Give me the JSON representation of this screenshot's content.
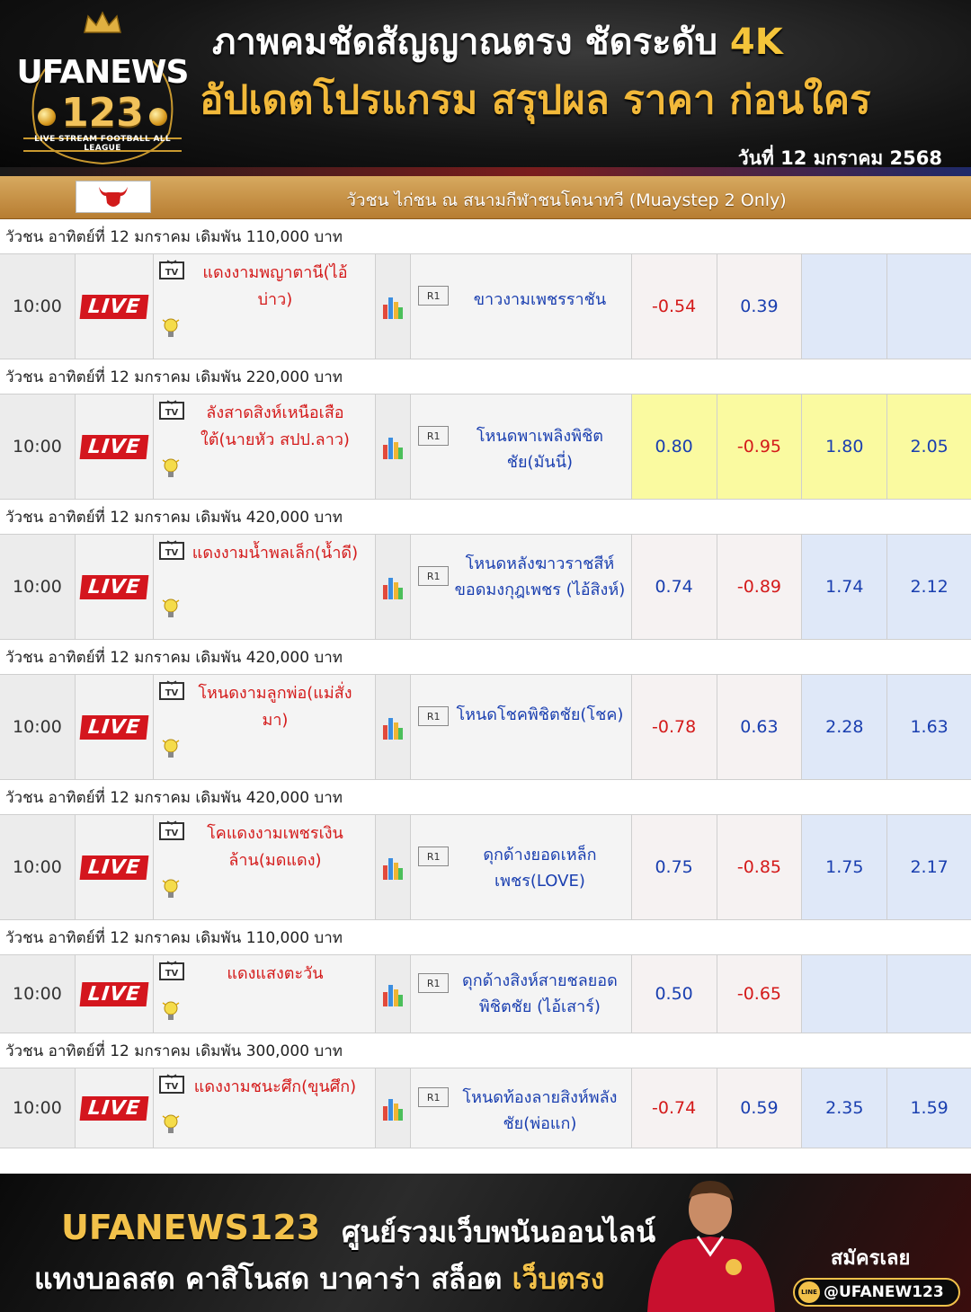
{
  "header": {
    "brand": "UFANEWS",
    "brand_number": "123",
    "tagline": "LIVE STREAM FOOTBALL ALL LEAGUE",
    "headline_1": "ภาพคมชัดสัญญาณตรง ชัดระดับ ",
    "headline_1_highlight": "4K",
    "headline_2": "อัปเดตโปรแกรม สรุปผล ราคา ก่อนใคร",
    "date": "วันที่ 12 มกราคม 2568"
  },
  "board": {
    "title": "วัวชน ไก่ชน ณ สนามกีฬาชนโคนาทวี (Muaystep 2 Only)",
    "live_label": "LIVE",
    "round_label": "R1",
    "matches": [
      {
        "event": "วัวชน อาทิตย์ที่ 12 มกราคม เดิมพัน 110,000 บาท",
        "time": "10:00",
        "red": "แดงงามพญาตานี(ไอ้บ่าว)",
        "blue": "ขาวงามเพชรราชัน",
        "odds": [
          "-0.54",
          "0.39",
          "",
          ""
        ]
      },
      {
        "event": "วัวชน อาทิตย์ที่ 12 มกราคม เดิมพัน 220,000 บาท",
        "time": "10:00",
        "red": "ลังสาดสิงห์เหนือเสือใต้(นายหัว สปป.ลาว)",
        "blue": "โหนดพาเพลิงพิชิตชัย(มันนี่)",
        "odds": [
          "0.80",
          "-0.95",
          "1.80",
          "2.05"
        ]
      },
      {
        "event": "วัวชน อาทิตย์ที่ 12 มกราคม เดิมพัน 420,000 บาท",
        "time": "10:00",
        "red": "แดงงามน้ำพลเล็ก(น้ำดี)",
        "blue": "โหนดหลังฆาวราชสีห์ขอดมงกุฎเพชร (ไอ้สิงห์)",
        "odds": [
          "0.74",
          "-0.89",
          "1.74",
          "2.12"
        ]
      },
      {
        "event": "วัวชน อาทิตย์ที่ 12 มกราคม เดิมพัน 420,000 บาท",
        "time": "10:00",
        "red": "โหนดงามลูกพ่อ(แม่สั่งมา)",
        "blue": "โหนดโชคพิชิตชัย(โชค)",
        "odds": [
          "-0.78",
          "0.63",
          "2.28",
          "1.63"
        ]
      },
      {
        "event": "วัวชน อาทิตย์ที่ 12 มกราคม เดิมพัน 420,000 บาท",
        "time": "10:00",
        "red": "โคแดงงามเพชรเงินล้าน(มดแดง)",
        "blue": "ดุกด้างยอดเหล็กเพชร(LOVE)",
        "odds": [
          "0.75",
          "-0.85",
          "1.75",
          "2.17"
        ]
      },
      {
        "event": "วัวชน อาทิตย์ที่ 12 มกราคม เดิมพัน 110,000 บาท",
        "time": "10:00",
        "red": "แดงแสงตะวัน",
        "blue": "ดุกด้างสิงห์สายชลยอดพิชิตชัย (ไอ้เสาร์)",
        "odds": [
          "0.50",
          "-0.65",
          "",
          ""
        ]
      },
      {
        "event": "วัวชน อาทิตย์ที่ 12 มกราคม เดิมพัน 300,000 บาท",
        "time": "10:00",
        "red": "แดงงามชนะศึก(ขุนศึก)",
        "blue": "โหนดท้องลายสิงห์พลังชัย(พ่อแก)",
        "odds": [
          "-0.74",
          "0.59",
          "2.35",
          "1.59"
        ]
      }
    ]
  },
  "footer": {
    "brand": "UFANEWS123",
    "subtitle_1": "ศูนย์รวมเว็บพนันออนไลน์",
    "subtitle_2": "แทงบอลสด คาสิโนสด บาคาร่า สล็อต ",
    "subtitle_2_highlight": "เว็บตรง",
    "signup": "สมัครเลย",
    "line_id": "@UFANEW123",
    "line_logo_text": "LINE"
  },
  "colors": {
    "accent_gold": "#f2c14a",
    "title_bar": "#c58d3f",
    "live_red": "#d41a1a",
    "blue_text": "#1a3fb0",
    "odds_blue_bg": "#dfe8f8",
    "odds_yellow_bg": "#fafaa0"
  }
}
